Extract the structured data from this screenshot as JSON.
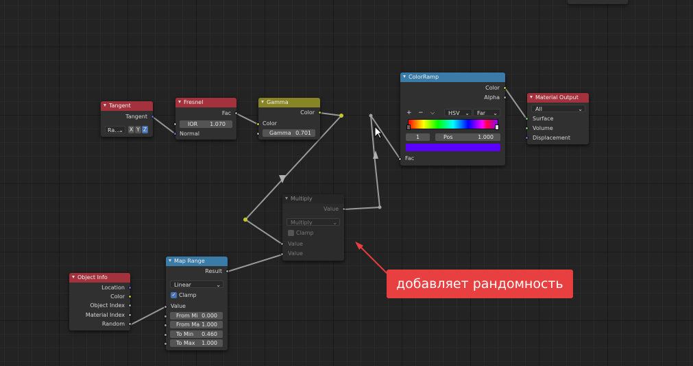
{
  "nodes": {
    "tangent": {
      "title": "Tangent",
      "out_tangent": "Tangent",
      "axis_mode": "Ra...",
      "x": "X",
      "y": "Y",
      "z": "Z"
    },
    "fresnel": {
      "title": "Fresnel",
      "out_fac": "Fac",
      "ior_label": "IOR",
      "ior_value": "1.070",
      "in_normal": "Normal"
    },
    "gamma": {
      "title": "Gamma",
      "out_color": "Color",
      "in_color": "Color",
      "gamma_label": "Gamma",
      "gamma_value": "0.701"
    },
    "colorramp": {
      "title": "ColorRamp",
      "out_color": "Color",
      "out_alpha": "Alpha",
      "add": "+",
      "remove": "−",
      "menu": "⌵",
      "color_mode": "HSV",
      "interp": "Far",
      "stop_index": "1",
      "pos_label": "Pos",
      "pos_value": "1.000",
      "in_fac": "Fac",
      "active_color": "#5a00ff"
    },
    "material_output": {
      "title": "Material Output",
      "target": "All",
      "in_surface": "Surface",
      "in_volume": "Volume",
      "in_displacement": "Displacement"
    },
    "multiply": {
      "title": "Multiply",
      "out_value": "Value",
      "operation": "Multiply",
      "clamp": "Clamp",
      "in_value1": "Value",
      "in_value2": "Value"
    },
    "map_range": {
      "title": "Map Range",
      "out_result": "Result",
      "interp": "Linear",
      "clamp": "Clamp",
      "in_value": "Value",
      "from_min_label": "From Mi",
      "from_min": "0.000",
      "from_max_label": "From Ma",
      "from_max": "1.000",
      "to_min_label": "To Min",
      "to_min": "0.460",
      "to_max_label": "To Max",
      "to_max": "1.000"
    },
    "object_info": {
      "title": "Object Info",
      "location": "Location",
      "color": "Color",
      "object_index": "Object Index",
      "material_index": "Material Index",
      "random": "Random"
    }
  },
  "annotation": {
    "text": "добавляет рандомность",
    "color": "#e84040"
  },
  "colors": {
    "node_red": "#a4323c",
    "node_blue": "#3a7ba7",
    "node_olive": "#888624",
    "socket_gray": "#a1a1a1",
    "socket_yellow": "#c7c729",
    "socket_blue": "#6363c7",
    "socket_green": "#63c763"
  }
}
